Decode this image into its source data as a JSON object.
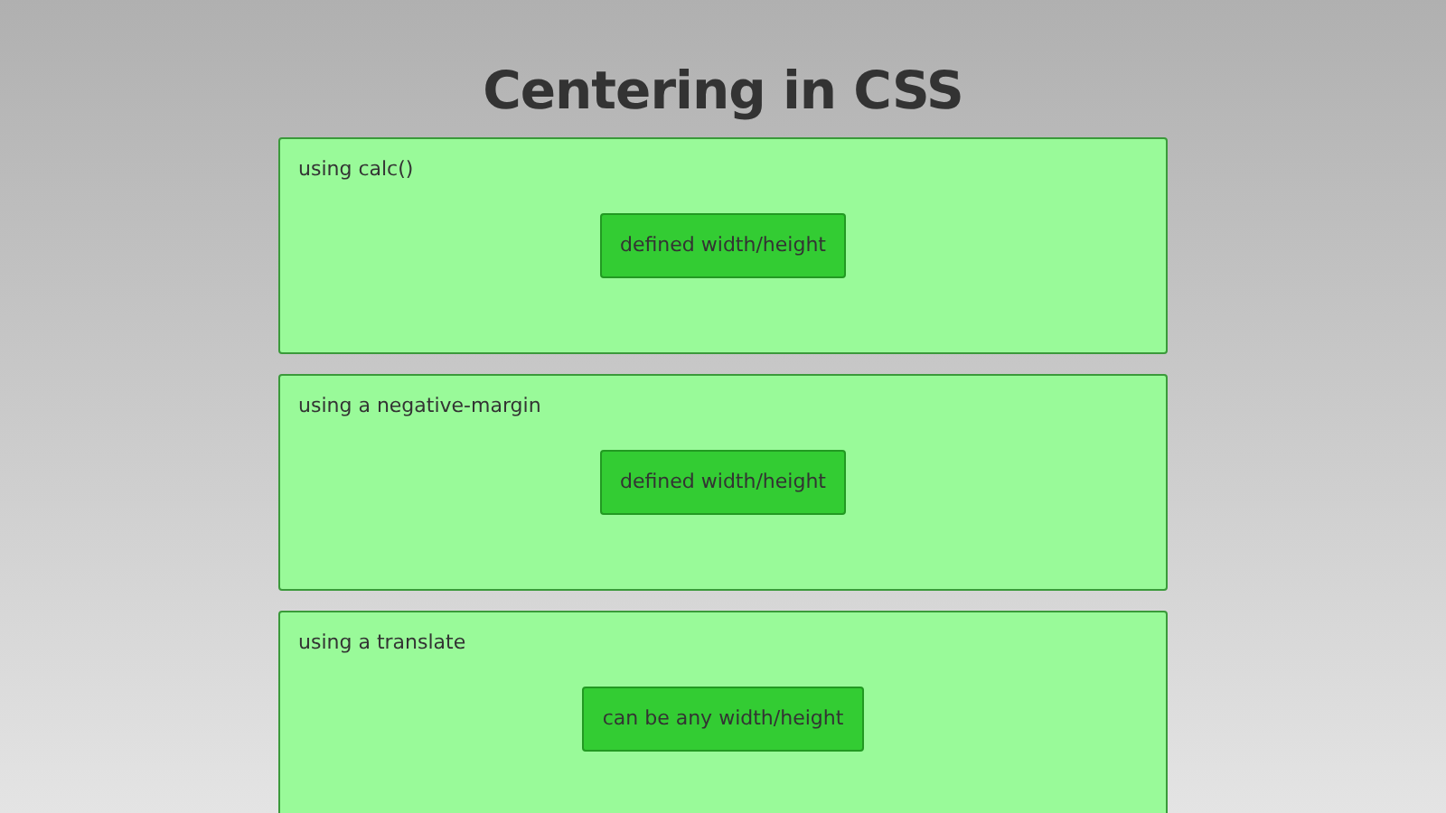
{
  "title": "Centering in CSS",
  "panels": [
    {
      "label": "using calc()",
      "box": "defined width/height"
    },
    {
      "label": "using a negative-margin",
      "box": "defined width/height"
    },
    {
      "label": "using a translate",
      "box": "can be any width/height"
    }
  ]
}
